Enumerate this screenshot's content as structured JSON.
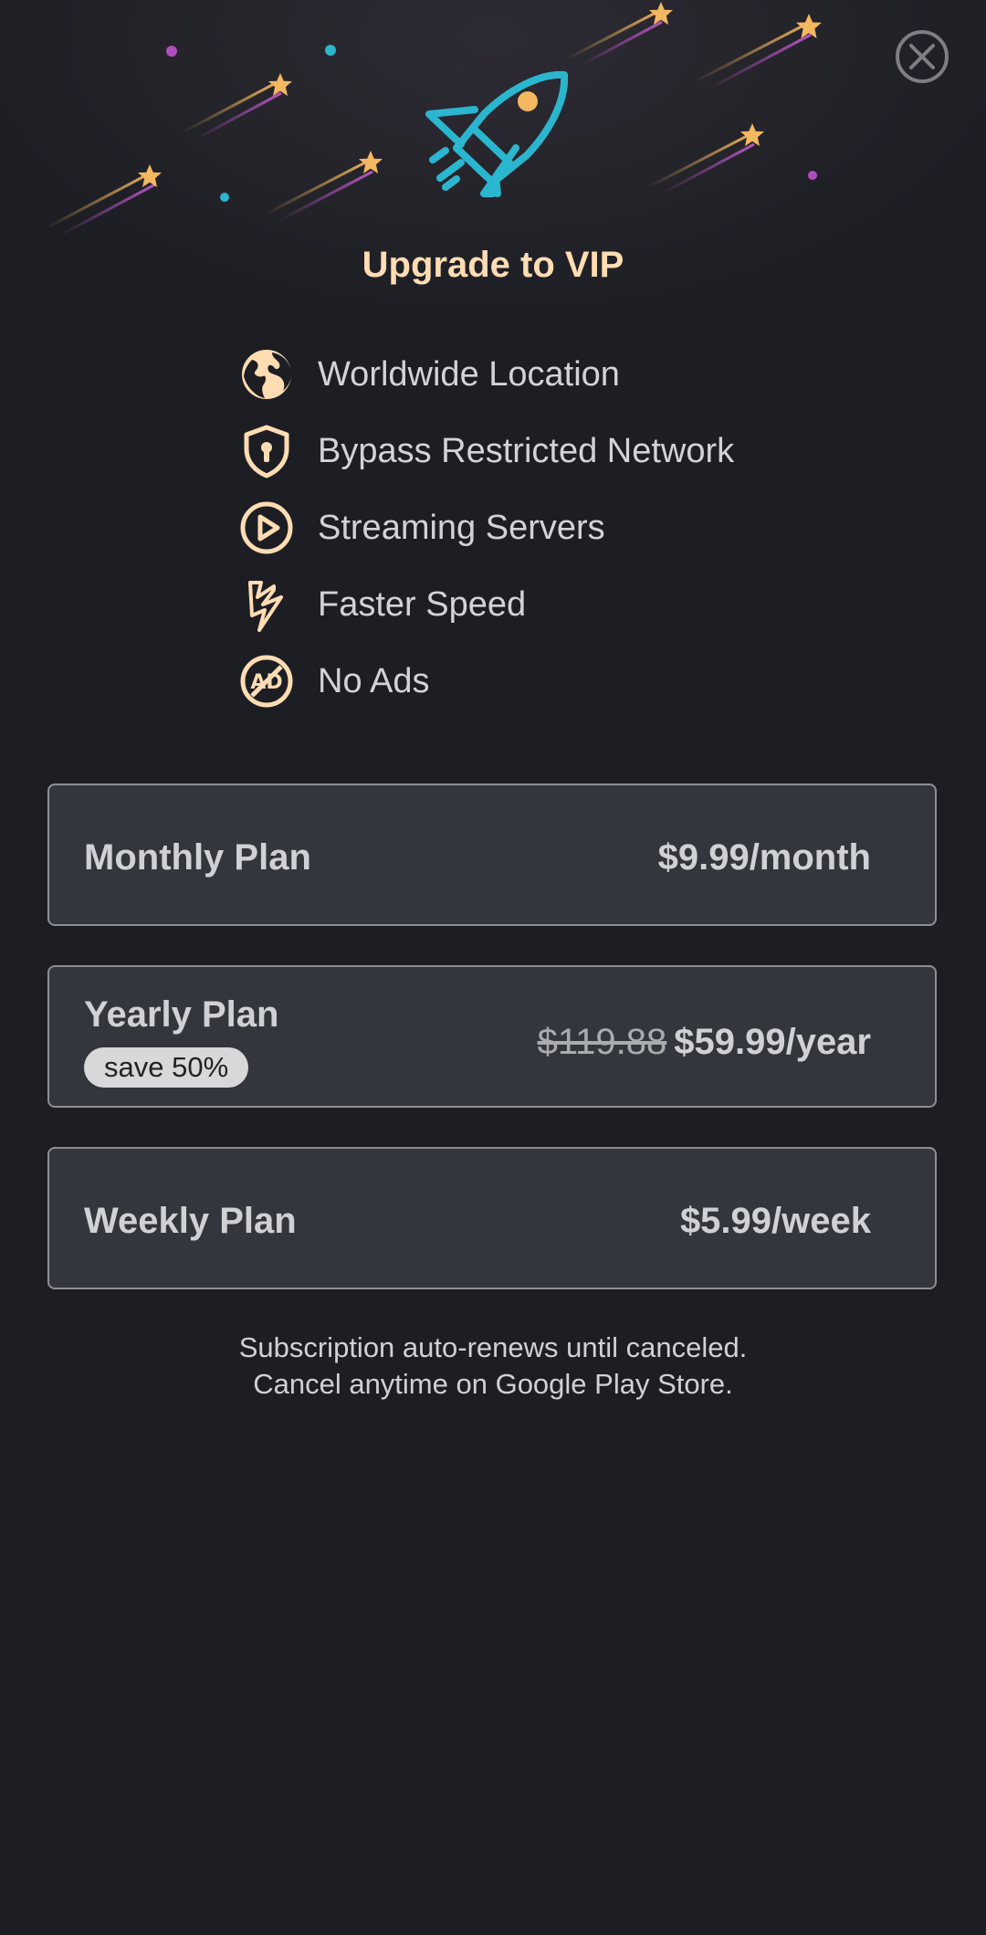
{
  "header": {
    "title": "Upgrade to VIP",
    "close_icon": "close-circle-icon",
    "illustration_icon": "rocket-icon"
  },
  "features": [
    {
      "icon": "globe-icon",
      "label": "Worldwide Location"
    },
    {
      "icon": "shield-keyhole-icon",
      "label": "Bypass Restricted Network"
    },
    {
      "icon": "play-circle-icon",
      "label": "Streaming Servers"
    },
    {
      "icon": "lightning-icon",
      "label": "Faster Speed"
    },
    {
      "icon": "no-ads-icon",
      "label": "No Ads"
    }
  ],
  "plans": {
    "monthly": {
      "name": "Monthly Plan",
      "price": "$9.99/month"
    },
    "yearly": {
      "name": "Yearly Plan",
      "badge": "save 50%",
      "old_price": "$119.88",
      "price": "$59.99/year"
    },
    "weekly": {
      "name": "Weekly Plan",
      "price": "$5.99/week"
    }
  },
  "footer": {
    "line1": "Subscription auto-renews until canceled.",
    "line2": "Cancel anytime on Google Play Store."
  },
  "colors": {
    "background": "#1c1e24",
    "accent_title": "#ffdcb2",
    "rocket": "#2bb6cf",
    "star": "#f4b860",
    "card": "#33363d"
  }
}
